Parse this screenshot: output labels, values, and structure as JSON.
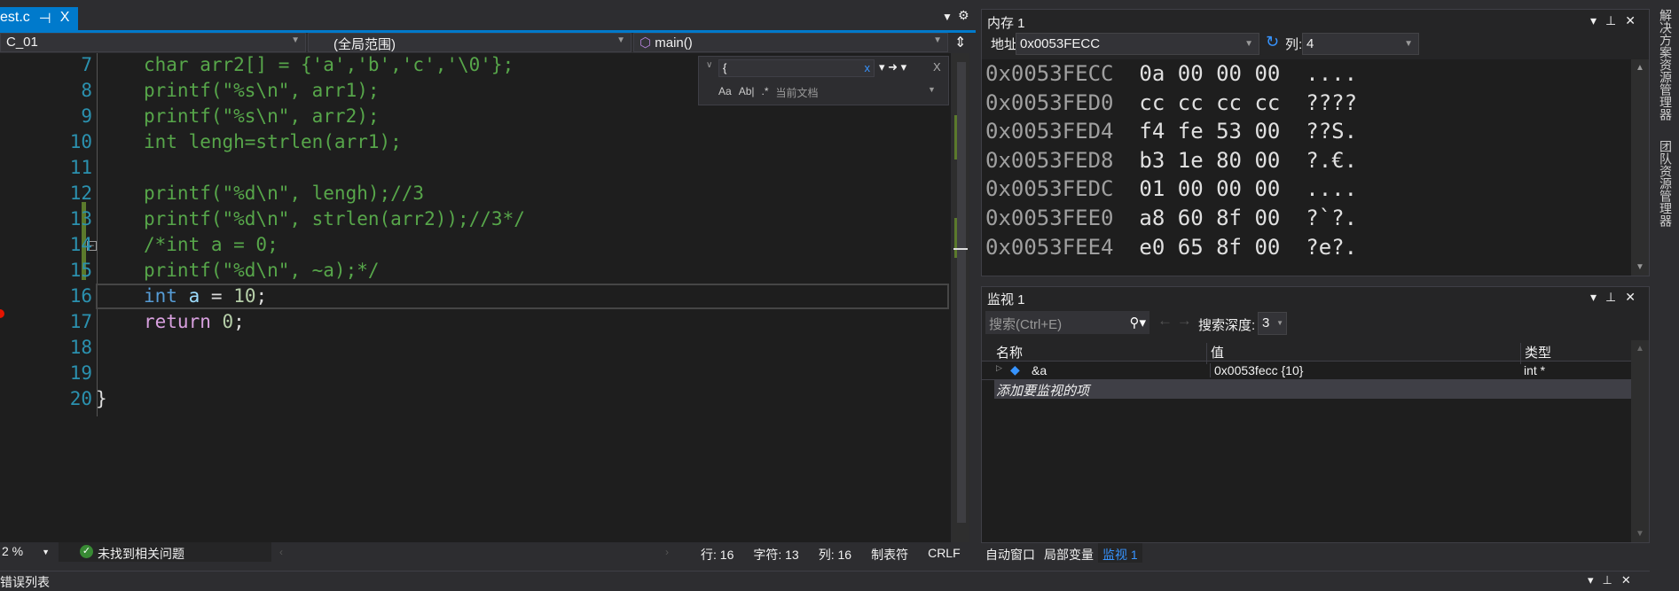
{
  "editor": {
    "tab_label": "est.c",
    "tab_pin": "⊣",
    "tab_close": "X",
    "nav_project": "C_01",
    "nav_scope": "(全局范围)",
    "nav_function": "main()",
    "lines": [
      {
        "n": "7",
        "code": "char arr2[] = {'a','b','c','\\0'};"
      },
      {
        "n": "8",
        "code": "printf(\"%s\\n\", arr1);"
      },
      {
        "n": "9",
        "code": "printf(\"%s\\n\", arr2);"
      },
      {
        "n": "10",
        "code": "int lengh=strlen(arr1);"
      },
      {
        "n": "11",
        "code": ""
      },
      {
        "n": "12",
        "code": "printf(\"%d\\n\", lengh);//3"
      },
      {
        "n": "13",
        "code": "printf(\"%d\\n\", strlen(arr2));//3*/"
      },
      {
        "n": "14",
        "code": "/*int a = 0;"
      },
      {
        "n": "15",
        "code": "printf(\"%d\\n\", ~a);*/"
      },
      {
        "n": "16",
        "kw": "int",
        "var": "a",
        "op": " = ",
        "num": "10",
        "end": ";"
      },
      {
        "n": "17",
        "ret": "return",
        "num": "0",
        "end": ";"
      },
      {
        "n": "18",
        "code": ""
      },
      {
        "n": "19",
        "code": ""
      },
      {
        "n": "20",
        "code": "}"
      }
    ],
    "find": {
      "value": "{",
      "scope": "当前文档",
      "opt_case": "Aa",
      "opt_word": "Ab|",
      "opt_regex": ".*"
    }
  },
  "status": {
    "zoom": "2 %",
    "issues": "未找到相关问题",
    "line": "行: 16",
    "char": "字符: 13",
    "col": "列: 16",
    "tabs": "制表符",
    "eol": "CRLF"
  },
  "memory": {
    "title": "内存 1",
    "address_label": "地址:",
    "address_value": "0x0053FECC",
    "columns_label": "列:",
    "columns_value": "4",
    "rows": [
      {
        "addr": "0x0053FECC",
        "bytes": "0a 00 00 00",
        "ascii": "...."
      },
      {
        "addr": "0x0053FED0",
        "bytes": "cc cc cc cc",
        "ascii": "????"
      },
      {
        "addr": "0x0053FED4",
        "bytes": "f4 fe 53 00",
        "ascii": "??S."
      },
      {
        "addr": "0x0053FED8",
        "bytes": "b3 1e 80 00",
        "ascii": "?.€."
      },
      {
        "addr": "0x0053FEDC",
        "bytes": "01 00 00 00",
        "ascii": "...."
      },
      {
        "addr": "0x0053FEE0",
        "bytes": "a8 60 8f 00",
        "ascii": "?`?."
      },
      {
        "addr": "0x0053FEE4",
        "bytes": "e0 65 8f 00",
        "ascii": "?e?."
      }
    ]
  },
  "watch": {
    "title": "监视 1",
    "search_placeholder": "搜索(Ctrl+E)",
    "depth_label": "搜索深度:",
    "depth_value": "3",
    "headers": [
      "名称",
      "值",
      "类型"
    ],
    "rows": [
      {
        "name": "&a",
        "value": "0x0053fecc {10}",
        "type": "int *"
      }
    ],
    "add_placeholder": "添加要监视的项",
    "tabs": [
      "自动窗口",
      "局部变量",
      "监视 1"
    ]
  },
  "side_tabs": [
    "解决方案资源管理器",
    "团队资源管理器"
  ],
  "bottom_panel": {
    "title": "错误列表"
  },
  "colors": {
    "accent": "#007acc",
    "comment": "#57a64a",
    "keyword": "#569cd6",
    "line_number": "#2b91af"
  }
}
